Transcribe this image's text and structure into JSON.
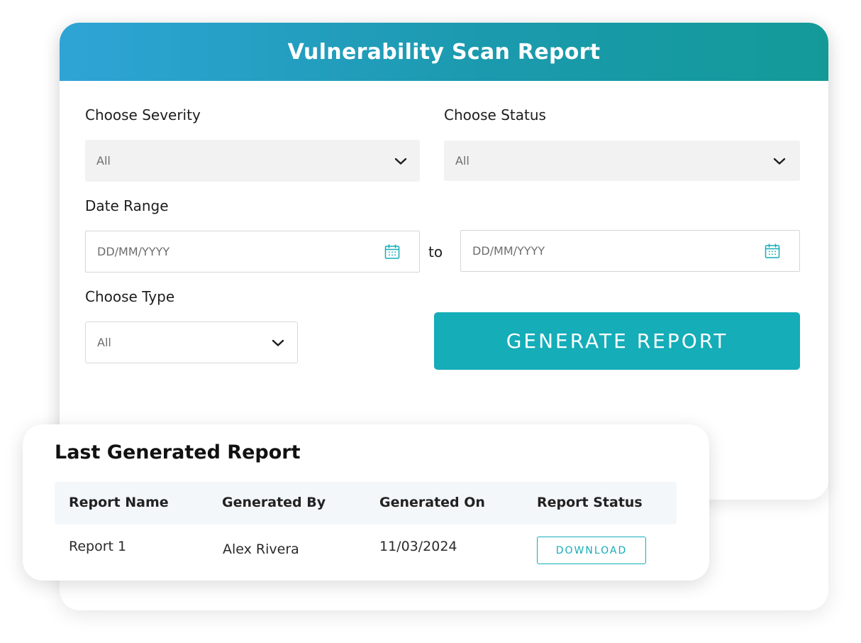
{
  "header": {
    "title": "Vulnerability Scan Report"
  },
  "form": {
    "severity": {
      "label": "Choose Severity",
      "value": "All"
    },
    "status": {
      "label": "Choose Status",
      "value": "All"
    },
    "date_range": {
      "label": "Date Range",
      "from_placeholder": "DD/MM/YYYY",
      "separator": "to",
      "to_placeholder": "DD/MM/YYYY"
    },
    "type": {
      "label": "Choose Type",
      "value": "All"
    },
    "generate_label": "GENERATE REPORT"
  },
  "last_report": {
    "title": "Last Generated Report",
    "columns": [
      "Report Name",
      "Generated By",
      "Generated On",
      "Report Status"
    ],
    "rows": [
      {
        "name": "Report 1",
        "by": "Alex Rivera",
        "on": "11/03/2024",
        "status_action": "DOWNLOAD"
      }
    ]
  },
  "icons": {
    "dropdown": "chevron-down-icon",
    "calendar": "calendar-icon"
  },
  "colors": {
    "header_gradient_start": "#2ea4d6",
    "header_gradient_end": "#139a98",
    "accent": "#14adb8"
  }
}
